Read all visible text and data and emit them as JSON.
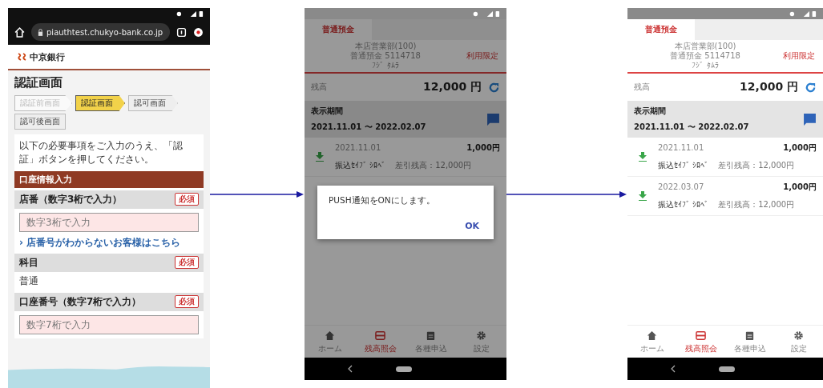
{
  "browser_phone": {
    "url": "piauthtest.chukyo-bank.co.jp",
    "bank_name": "中京銀行",
    "page_title": "認証画面",
    "steps": [
      {
        "label": "認証前画面",
        "selected": false,
        "done": true
      },
      {
        "label": "認証画面",
        "selected": true,
        "done": false
      },
      {
        "label": "認可画面",
        "selected": false,
        "done": false
      },
      {
        "label": "認可後画面",
        "selected": false,
        "done": false
      }
    ],
    "instructions": "以下の必要事項をご入力のうえ、「認証」ボタンを押してください。",
    "section_header": "口座情報入力",
    "fields": [
      {
        "kind": "label",
        "text": "店番（数字3桁で入力）",
        "badge": "必須"
      },
      {
        "kind": "input",
        "placeholder": "数字3桁で入力"
      },
      {
        "kind": "link",
        "text": "› 店番号がわからないお客様はこちら"
      },
      {
        "kind": "label",
        "text": "科目",
        "badge": "必須"
      },
      {
        "kind": "value",
        "text": "普通"
      },
      {
        "kind": "label",
        "text": "口座番号（数字7桁で入力）",
        "badge": "必須"
      },
      {
        "kind": "input",
        "placeholder": "数字7桁で入力"
      }
    ]
  },
  "app_screens": [
    {
      "dialog": {
        "message": "PUSH通知をONにします。",
        "button": "OK"
      },
      "tab": "普通預金",
      "branch": "本店営業部(100)",
      "account": "普通預金 5114718",
      "holder": "ﾌｼﾞ ﾀﾑﾗ",
      "limit_link": "利用限定",
      "balance_label": "残高",
      "balance": "12,000 円",
      "period_label": "表示期間",
      "period": "2021.11.01 〜 2022.02.07",
      "transactions": [
        {
          "date": "2021.11.01",
          "amount": "1,000円",
          "description": "振込ｾｲﾌﾞ ｼﾛﾍﾞ",
          "balance": "差引残高：12,000円"
        }
      ],
      "nav": [
        {
          "label": "ホーム",
          "selected": false
        },
        {
          "label": "残高照会",
          "selected": true
        },
        {
          "label": "各種申込",
          "selected": false
        },
        {
          "label": "設定",
          "selected": false
        }
      ]
    },
    {
      "tab": "普通預金",
      "branch": "本店営業部(100)",
      "account": "普通預金 5114718",
      "holder": "ﾌｼﾞ ﾀﾑﾗ",
      "limit_link": "利用限定",
      "balance_label": "残高",
      "balance": "12,000 円",
      "period_label": "表示期間",
      "period": "2021.11.01 〜 2022.02.07",
      "transactions": [
        {
          "date": "2021.11.01",
          "amount": "1,000円",
          "description": "振込ｾｲﾌﾞ ｼﾛﾍﾞ",
          "balance": "差引残高：12,000円"
        },
        {
          "date": "2022.03.07",
          "amount": "1,000円",
          "description": "振込ｾｲﾌﾞ ｼﾛﾍﾞ",
          "balance": "差引残高：12,000円"
        }
      ],
      "nav": [
        {
          "label": "ホーム",
          "selected": false
        },
        {
          "label": "残高照会",
          "selected": true
        },
        {
          "label": "各種申込",
          "selected": false
        },
        {
          "label": "設定",
          "selected": false
        }
      ]
    }
  ]
}
